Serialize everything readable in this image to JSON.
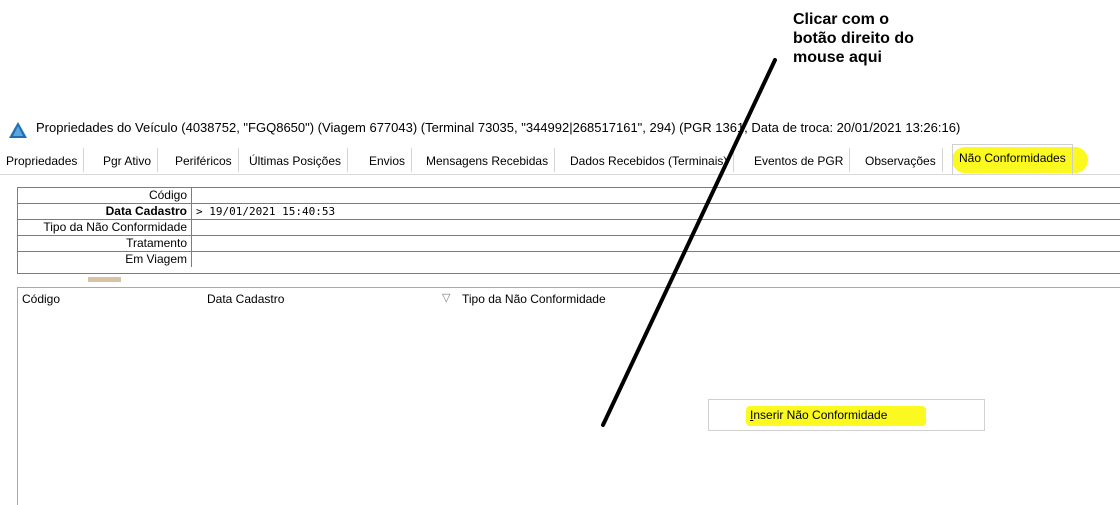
{
  "annotation": {
    "lines": [
      "Clicar com o",
      "botão direito do",
      "mouse aqui"
    ]
  },
  "window": {
    "icon": "app-triangle-icon",
    "title": "Propriedades do Veículo (4038752, \"FGQ8650\") (Viagem 677043) (Terminal 73035, \"344992|268517161\", 294) (PGR 1361, Data de troca: 20/01/2021 13:26:16)"
  },
  "tabs": [
    {
      "label": "Propriedades"
    },
    {
      "label": "Pgr Ativo"
    },
    {
      "label": "Periféricos"
    },
    {
      "label": "Últimas Posições"
    },
    {
      "label": "Envios"
    },
    {
      "label": "Mensagens Recebidas"
    },
    {
      "label": "Dados Recebidos (Terminais)"
    },
    {
      "label": "Eventos de PGR"
    },
    {
      "label": "Observações"
    },
    {
      "label": "Não Conformidades",
      "active": true
    }
  ],
  "form": {
    "rows": [
      {
        "label": "Código",
        "value": ""
      },
      {
        "label": "Data Cadastro",
        "value": "> 19/01/2021 15:40:53",
        "bold": true
      },
      {
        "label": "Tipo da Não Conformidade",
        "value": ""
      },
      {
        "label": "Tratamento",
        "value": ""
      },
      {
        "label": "Em Viagem",
        "value": ""
      }
    ]
  },
  "list": {
    "columns": [
      {
        "label": "Código"
      },
      {
        "label": "Data Cadastro"
      },
      {
        "label": "Tipo da Não Conformidade"
      }
    ],
    "sort_icon": "sort-down-triangle-icon"
  },
  "context_menu": {
    "items": [
      {
        "label": "Inserir Não Conformidade",
        "mnemonic": "I",
        "rest": "nserir Não Conformidade"
      }
    ]
  },
  "colors": {
    "highlight": "#fbf91f",
    "grid_border": "#3a8fd0",
    "icon_blue": "#1e6fb3"
  }
}
